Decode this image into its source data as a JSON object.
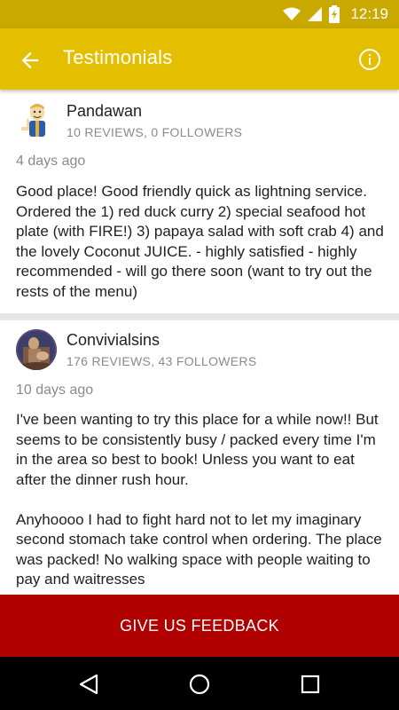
{
  "status_bar": {
    "time": "12:19",
    "icons": [
      "wifi-icon",
      "signal-icon",
      "battery-charging-icon"
    ]
  },
  "app_bar": {
    "title": "Testimonials",
    "back_icon": "arrow-back-icon",
    "info_icon": "info-icon"
  },
  "reviews": [
    {
      "name": "Pandawan",
      "stats": "10 REVIEWS, 0 FOLLOWERS",
      "date": "4 days ago",
      "avatar_icon": "thumbs-up-mascot-avatar",
      "text": "Good place! Good friendly quick as lightning service. Ordered the 1) red duck curry 2) special seafood hot plate (with FIRE!) 3) papaya salad with soft crab 4) and the lovely Coconut JUICE. - highly satisfied - highly recommended - will go there soon (want to try out the rests of the menu)"
    },
    {
      "name": "Convivialsins",
      "stats": "176 REVIEWS, 43 FOLLOWERS",
      "date": "10 days ago",
      "avatar_icon": "photo-avatar",
      "text": "I've been wanting to try this place for a while now!! But seems to be consistently busy / packed every time I'm in the area so best to book! Unless you want to eat after the dinner rush hour.\n\nAnyhoooo I had to fight hard not to let my imaginary second stomach take control when ordering. The place was packed! No walking space with people waiting to pay and waitresses"
    }
  ],
  "feedback_button": {
    "label": "GIVE US FEEDBACK"
  },
  "nav_bar": {
    "icons": [
      "nav-back-icon",
      "nav-home-icon",
      "nav-recents-icon"
    ]
  },
  "colors": {
    "status_bar": "#c9a800",
    "app_bar": "#e3bf00",
    "feedback": "#b00000",
    "secondary_text": "#8a8a8a"
  }
}
